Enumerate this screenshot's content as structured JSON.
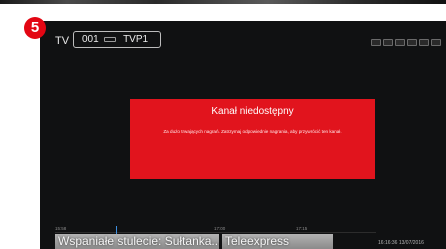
{
  "step_number": "5",
  "header": {
    "source_label": "TV",
    "channel_number": "001",
    "channel_name": "TVP1"
  },
  "status_icons": [
    "signal-icon",
    "rec-icon",
    "lock-icon",
    "subtitles-icon",
    "audio-icon",
    "hd-icon",
    "info-icon"
  ],
  "dialog": {
    "title": "Kanał niedostępny",
    "message": "Za dużo trwających nagrań. Zatrzymaj odpowiednie nagrania, aby przywrócić ten kanał."
  },
  "timeline": {
    "time_labels": [
      "15:58",
      "17:00",
      "17:15"
    ]
  },
  "programs": [
    {
      "title": "Wspaniałe stulecie: Sułtanka..."
    },
    {
      "title": "Teleexpress"
    }
  ],
  "clock": "16:16:36 13/07/2016",
  "colors": {
    "accent_red": "#e1141d",
    "screen_bg": "#101112",
    "now_marker": "#3d8fe0"
  }
}
